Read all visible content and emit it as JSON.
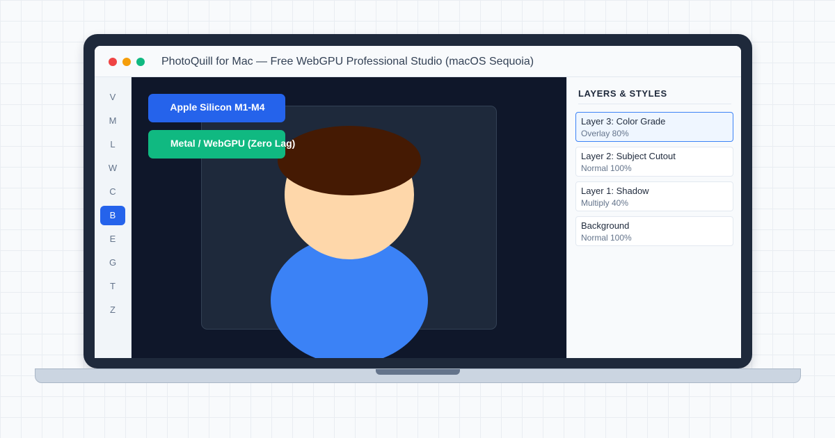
{
  "window": {
    "title": "PhotoQuill for Mac — Free WebGPU Professional Studio (macOS Sequoia)"
  },
  "colors": {
    "accent": "#2563eb",
    "success": "#10b981",
    "canvas_background": "#0f172a",
    "traffic_close": "#ef4444",
    "traffic_minimize": "#f59e0b",
    "traffic_zoom": "#10b981"
  },
  "toolbar": {
    "tools": [
      {
        "label": "V",
        "active": false
      },
      {
        "label": "M",
        "active": false
      },
      {
        "label": "L",
        "active": false
      },
      {
        "label": "W",
        "active": false
      },
      {
        "label": "C",
        "active": false
      },
      {
        "label": "B",
        "active": true
      },
      {
        "label": "E",
        "active": false
      },
      {
        "label": "G",
        "active": false
      },
      {
        "label": "T",
        "active": false
      },
      {
        "label": "Z",
        "active": false
      }
    ]
  },
  "canvas": {
    "badges": [
      {
        "icon": "apple-icon",
        "icon_glyph": "",
        "label": "Apple Silicon M1-M4"
      },
      {
        "icon": "apple-icon",
        "icon_glyph": "",
        "label": "Metal / WebGPU (Zero Lag)"
      }
    ]
  },
  "layers_panel": {
    "title": "LAYERS & STYLES",
    "layers": [
      {
        "name": "Layer 3: Color Grade",
        "blend": "Overlay 80%",
        "selected": true
      },
      {
        "name": "Layer 2: Subject Cutout",
        "blend": "Normal 100%",
        "selected": false
      },
      {
        "name": "Layer 1: Shadow",
        "blend": "Multiply 40%",
        "selected": false
      },
      {
        "name": "Background",
        "blend": "Normal 100%",
        "selected": false
      }
    ]
  }
}
